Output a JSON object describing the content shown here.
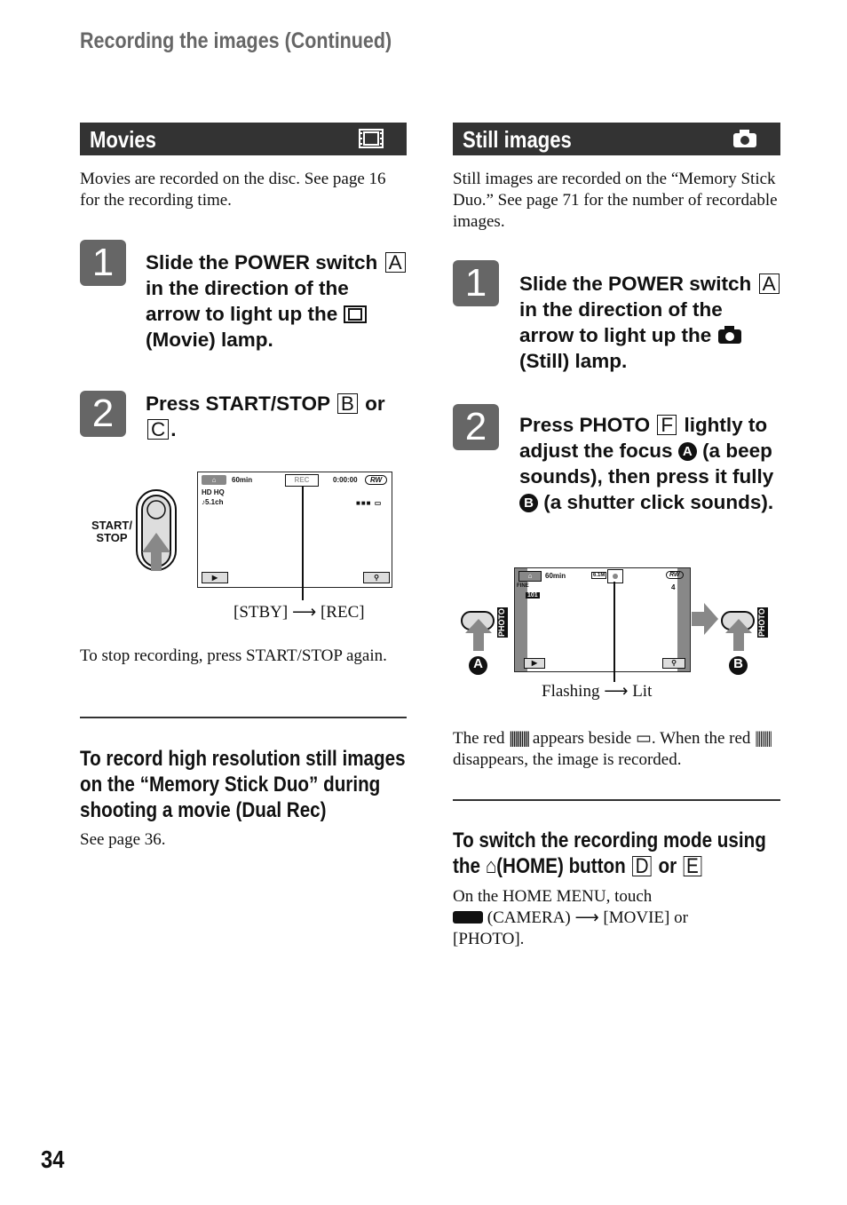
{
  "running_head": "Recording the images (Continued)",
  "page_number": "34",
  "movies": {
    "title": "Movies",
    "icon": "film-icon",
    "intro": "Movies are recorded on the disc. See page 16 for the recording time.",
    "steps": [
      {
        "num": "1",
        "parts": [
          "Slide the POWER switch",
          "A",
          "in the direction of the arrow to light up the",
          "(Movie) lamp."
        ]
      },
      {
        "num": "2",
        "parts": [
          "Press START/STOP",
          "B",
          "or",
          "C",
          "."
        ]
      }
    ],
    "figure": {
      "button_label": "START/ STOP",
      "battery": "60min",
      "rec": "REC",
      "time": "0:00:00",
      "disc": "RW",
      "hd": "HD HQ",
      "audio": "♪5.1ch",
      "caption": "[STBY] ⟶ [REC]"
    },
    "stop_note": "To stop recording, press START/STOP again.",
    "dual_rec": {
      "heading": [
        "To record high resolution still images",
        "on the “Memory Stick Duo” during",
        "shooting a movie (Dual Rec)"
      ],
      "text": "See page 36."
    }
  },
  "still": {
    "title": "Still images",
    "icon": "camera-icon",
    "intro": "Still images are recorded on the “Memory Stick Duo.” See page 71 for the number of recordable images.",
    "steps": [
      {
        "num": "1",
        "parts": [
          "Slide the POWER switch",
          "A",
          "in the direction of the arrow to light up the",
          "(Still) lamp."
        ]
      },
      {
        "num": "2",
        "parts": [
          "Press PHOTO",
          "F",
          "lightly to adjust the focus",
          "A",
          "(a beep sounds), then press it fully",
          "B",
          "(a shutter click sounds)."
        ]
      }
    ],
    "figure": {
      "photo_label": "PHOTO",
      "battery": "60min",
      "size": "6.1M",
      "disc": "RW",
      "quality": "FINE",
      "folder": "101",
      "count": "4",
      "marker_a": "A",
      "marker_b": "B",
      "caption": "Flashing ⟶ Lit"
    },
    "note": [
      "The red",
      "appears beside",
      ". When the red",
      "disappears, the image is recorded."
    ],
    "switch_mode": {
      "heading": [
        "To switch the recording mode using",
        "the",
        "(HOME) button",
        "D",
        "or",
        "E"
      ],
      "text": [
        "On the HOME MENU, touch",
        "(CAMERA) ⟶ [MOVIE] or [PHOTO]."
      ]
    }
  }
}
